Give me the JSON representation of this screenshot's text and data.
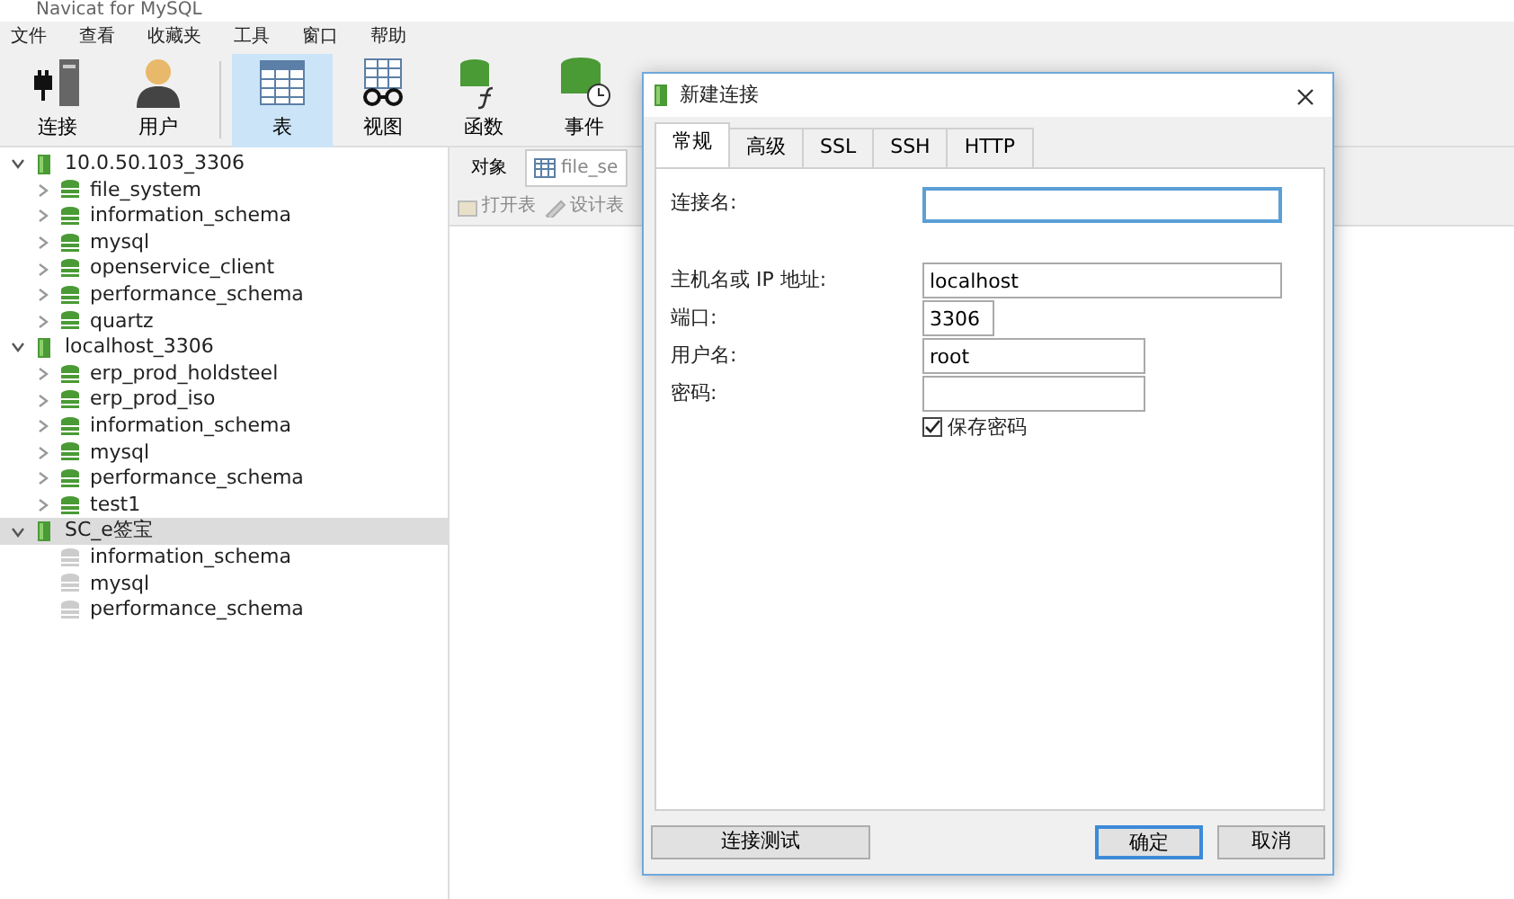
{
  "window": {
    "title": "Navicat for MySQL"
  },
  "menu": [
    "文件",
    "查看",
    "收藏夹",
    "工具",
    "窗口",
    "帮助"
  ],
  "toolbar": [
    {
      "label": "连接",
      "kind": "plug",
      "selected": false
    },
    {
      "label": "用户",
      "kind": "user",
      "selected": false
    },
    {
      "label": "表",
      "kind": "table",
      "selected": true
    },
    {
      "label": "视图",
      "kind": "view",
      "selected": false
    },
    {
      "label": "函数",
      "kind": "function",
      "selected": false
    },
    {
      "label": "事件",
      "kind": "event",
      "selected": false
    }
  ],
  "sidebar": {
    "items": [
      {
        "label": "10.0.50.103_3306",
        "expanded": true,
        "selected": false,
        "children": [
          {
            "label": "file_system",
            "open": true
          },
          {
            "label": "information_schema",
            "open": true
          },
          {
            "label": "mysql",
            "open": true
          },
          {
            "label": "openservice_client",
            "open": true
          },
          {
            "label": "performance_schema",
            "open": true
          },
          {
            "label": "quartz",
            "open": true
          }
        ]
      },
      {
        "label": "localhost_3306",
        "expanded": true,
        "selected": false,
        "children": [
          {
            "label": "erp_prod_holdsteel",
            "open": true
          },
          {
            "label": "erp_prod_iso",
            "open": true
          },
          {
            "label": "information_schema",
            "open": true
          },
          {
            "label": "mysql",
            "open": true
          },
          {
            "label": "performance_schema",
            "open": true
          },
          {
            "label": "test1",
            "open": true
          }
        ]
      },
      {
        "label": "SC_e签宝",
        "expanded": true,
        "selected": true,
        "children": [
          {
            "label": "information_schema",
            "open": false
          },
          {
            "label": "mysql",
            "open": false
          },
          {
            "label": "performance_schema",
            "open": false
          }
        ]
      }
    ]
  },
  "object_tabs": [
    {
      "label": "对象",
      "selected": true
    },
    {
      "label": "file_se",
      "selected": false
    }
  ],
  "object_toolbar": [
    {
      "label": "打开表",
      "disabled": true
    },
    {
      "label": "设计表",
      "disabled": true
    }
  ],
  "dialog": {
    "title": "新建连接",
    "tabs": [
      {
        "label": "常规",
        "selected": true
      },
      {
        "label": "高级",
        "selected": false
      },
      {
        "label": "SSL",
        "selected": false
      },
      {
        "label": "SSH",
        "selected": false
      },
      {
        "label": "HTTP",
        "selected": false
      }
    ],
    "fields": [
      {
        "label": "连接名:",
        "focused": true
      },
      {
        "label": "主机名或 IP 地址:",
        "value": "localhost",
        "focused": false
      },
      {
        "label": "端口:",
        "value": "3306",
        "focused": false
      },
      {
        "label": "用户名:",
        "value": "root",
        "focused": false
      },
      {
        "label": "密码:",
        "focused": false
      }
    ],
    "save_password": {
      "label": "保存密码",
      "checked": true
    },
    "buttons": [
      {
        "label": "连接测试",
        "default": false
      },
      {
        "label": "确定",
        "default": true
      },
      {
        "label": "取消",
        "default": false
      }
    ]
  }
}
